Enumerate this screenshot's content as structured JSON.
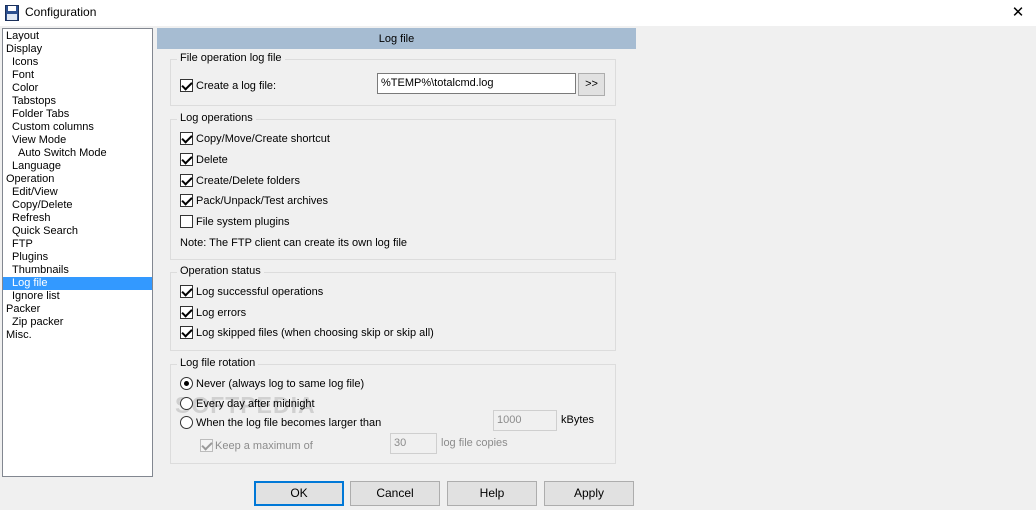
{
  "window": {
    "title": "Configuration",
    "close_glyph": "✕",
    "icon_text": "EN"
  },
  "tree": {
    "items": [
      {
        "label": "Layout",
        "level": 0
      },
      {
        "label": "Display",
        "level": 0
      },
      {
        "label": "Icons",
        "level": 1
      },
      {
        "label": "Font",
        "level": 1
      },
      {
        "label": "Color",
        "level": 1
      },
      {
        "label": "Tabstops",
        "level": 1
      },
      {
        "label": "Folder Tabs",
        "level": 1
      },
      {
        "label": "Custom columns",
        "level": 1
      },
      {
        "label": "View Mode",
        "level": 1
      },
      {
        "label": "Auto Switch Mode",
        "level": 2
      },
      {
        "label": "Language",
        "level": 1
      },
      {
        "label": "Operation",
        "level": 0
      },
      {
        "label": "Edit/View",
        "level": 1
      },
      {
        "label": "Copy/Delete",
        "level": 1
      },
      {
        "label": "Refresh",
        "level": 1
      },
      {
        "label": "Quick Search",
        "level": 1
      },
      {
        "label": "FTP",
        "level": 1
      },
      {
        "label": "Plugins",
        "level": 1
      },
      {
        "label": "Thumbnails",
        "level": 1
      },
      {
        "label": "Log file",
        "level": 1,
        "selected": true
      },
      {
        "label": "Ignore list",
        "level": 1
      },
      {
        "label": "Packer",
        "level": 0
      },
      {
        "label": "Zip packer",
        "level": 1
      },
      {
        "label": "Misc.",
        "level": 0
      }
    ]
  },
  "header": {
    "title": "Log file"
  },
  "file_group": {
    "title": "File operation log file",
    "create_label": "Create a log file:",
    "create_checked": true,
    "path_value": "%TEMP%\\totalcmd.log",
    "browse_label": ">>"
  },
  "ops_group": {
    "title": "Log operations",
    "items": [
      {
        "label": "Copy/Move/Create shortcut",
        "checked": true
      },
      {
        "label": "Delete",
        "checked": true
      },
      {
        "label": "Create/Delete folders",
        "checked": true
      },
      {
        "label": "Pack/Unpack/Test archives",
        "checked": true
      },
      {
        "label": "File system plugins",
        "checked": false
      }
    ],
    "note": "Note: The FTP client can create its own log file"
  },
  "status_group": {
    "title": "Operation status",
    "items": [
      {
        "label": "Log successful operations",
        "checked": true
      },
      {
        "label": "Log errors",
        "checked": true
      },
      {
        "label": "Log skipped files (when choosing skip or skip all)",
        "checked": true
      }
    ]
  },
  "rotation_group": {
    "title": "Log file rotation",
    "options": [
      {
        "label": "Never (always log to same log file)",
        "checked": true
      },
      {
        "label": "Every day after midnight",
        "checked": false
      },
      {
        "label": "When the log file becomes larger than",
        "checked": false
      }
    ],
    "size_value": "1000",
    "size_unit": "kBytes",
    "keep_label": "Keep a maximum of",
    "keep_checked": true,
    "copies_value": "30",
    "copies_unit": "log file copies"
  },
  "buttons": {
    "ok": "OK",
    "cancel": "Cancel",
    "help": "Help",
    "apply": "Apply"
  },
  "watermark": "SOFTPEDIA"
}
